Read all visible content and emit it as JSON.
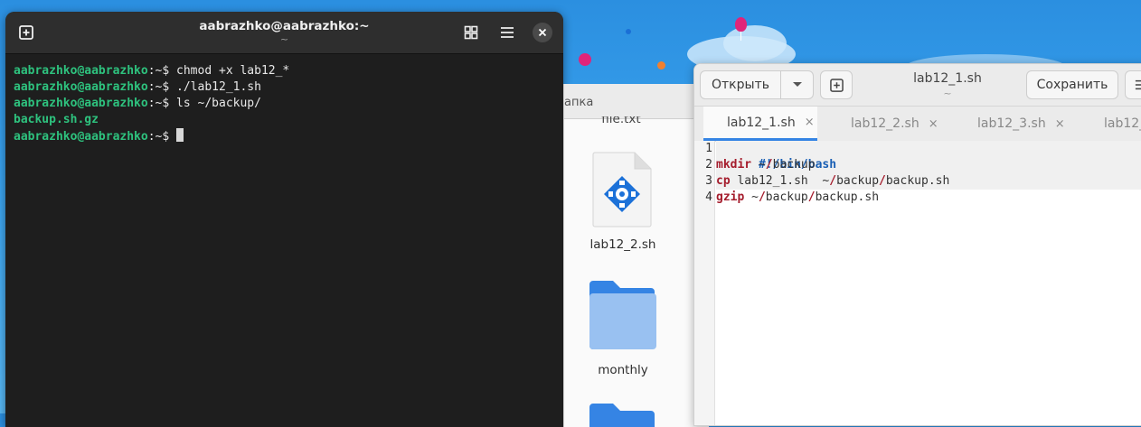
{
  "terminal": {
    "title": "aabrazhko@aabrazhko:~",
    "subtitle": "~",
    "lines": [
      {
        "user": "aabrazhko@aabrazhko",
        "sep": ":~$ ",
        "cmd": "chmod +x lab12_*"
      },
      {
        "user": "aabrazhko@aabrazhko",
        "sep": ":~$ ",
        "cmd": "./lab12_1.sh"
      },
      {
        "user": "aabrazhko@aabrazhko",
        "sep": ":~$ ",
        "cmd": "ls ~/backup/"
      },
      {
        "output": "backup.sh.gz"
      },
      {
        "user": "aabrazhko@aabrazhko",
        "sep": ":~$ ",
        "cmd": ""
      }
    ]
  },
  "files": {
    "title_fragment": "апка",
    "top_label_fragment": "file.txt",
    "items": [
      {
        "label": "lab12_2.sh",
        "icon": "script-file-icon"
      },
      {
        "label": "monthly",
        "icon": "folder-icon"
      }
    ]
  },
  "editor": {
    "open_label": "Открыть",
    "save_label": "Сохранить",
    "title": "lab12_1.sh",
    "subtitle": "~",
    "tabs": [
      {
        "label": "lab12_1.sh",
        "close": "×"
      },
      {
        "label": "lab12_2.sh",
        "close": "×"
      },
      {
        "label": "lab12_3.sh",
        "close": "×"
      },
      {
        "label": "lab12_",
        "close": ""
      }
    ],
    "line_numbers": [
      "1",
      "2",
      "3",
      "4"
    ],
    "code": {
      "l1": "#!/bin/bash",
      "l2_kw": "mkdir",
      "l2_rest": " ~",
      "l2_slash": "/",
      "l2_path": "backup",
      "l3_kw": "cp",
      "l3_rest": " lab12_1.sh  ~",
      "l3_slash1": "/",
      "l3_mid": "backup",
      "l3_slash2": "/",
      "l3_end": "backup.sh",
      "l4_kw": "gzip",
      "l4_rest": " ~",
      "l4_slash1": "/",
      "l4_mid": "backup",
      "l4_slash2": "/",
      "l4_end": "backup.sh"
    }
  }
}
